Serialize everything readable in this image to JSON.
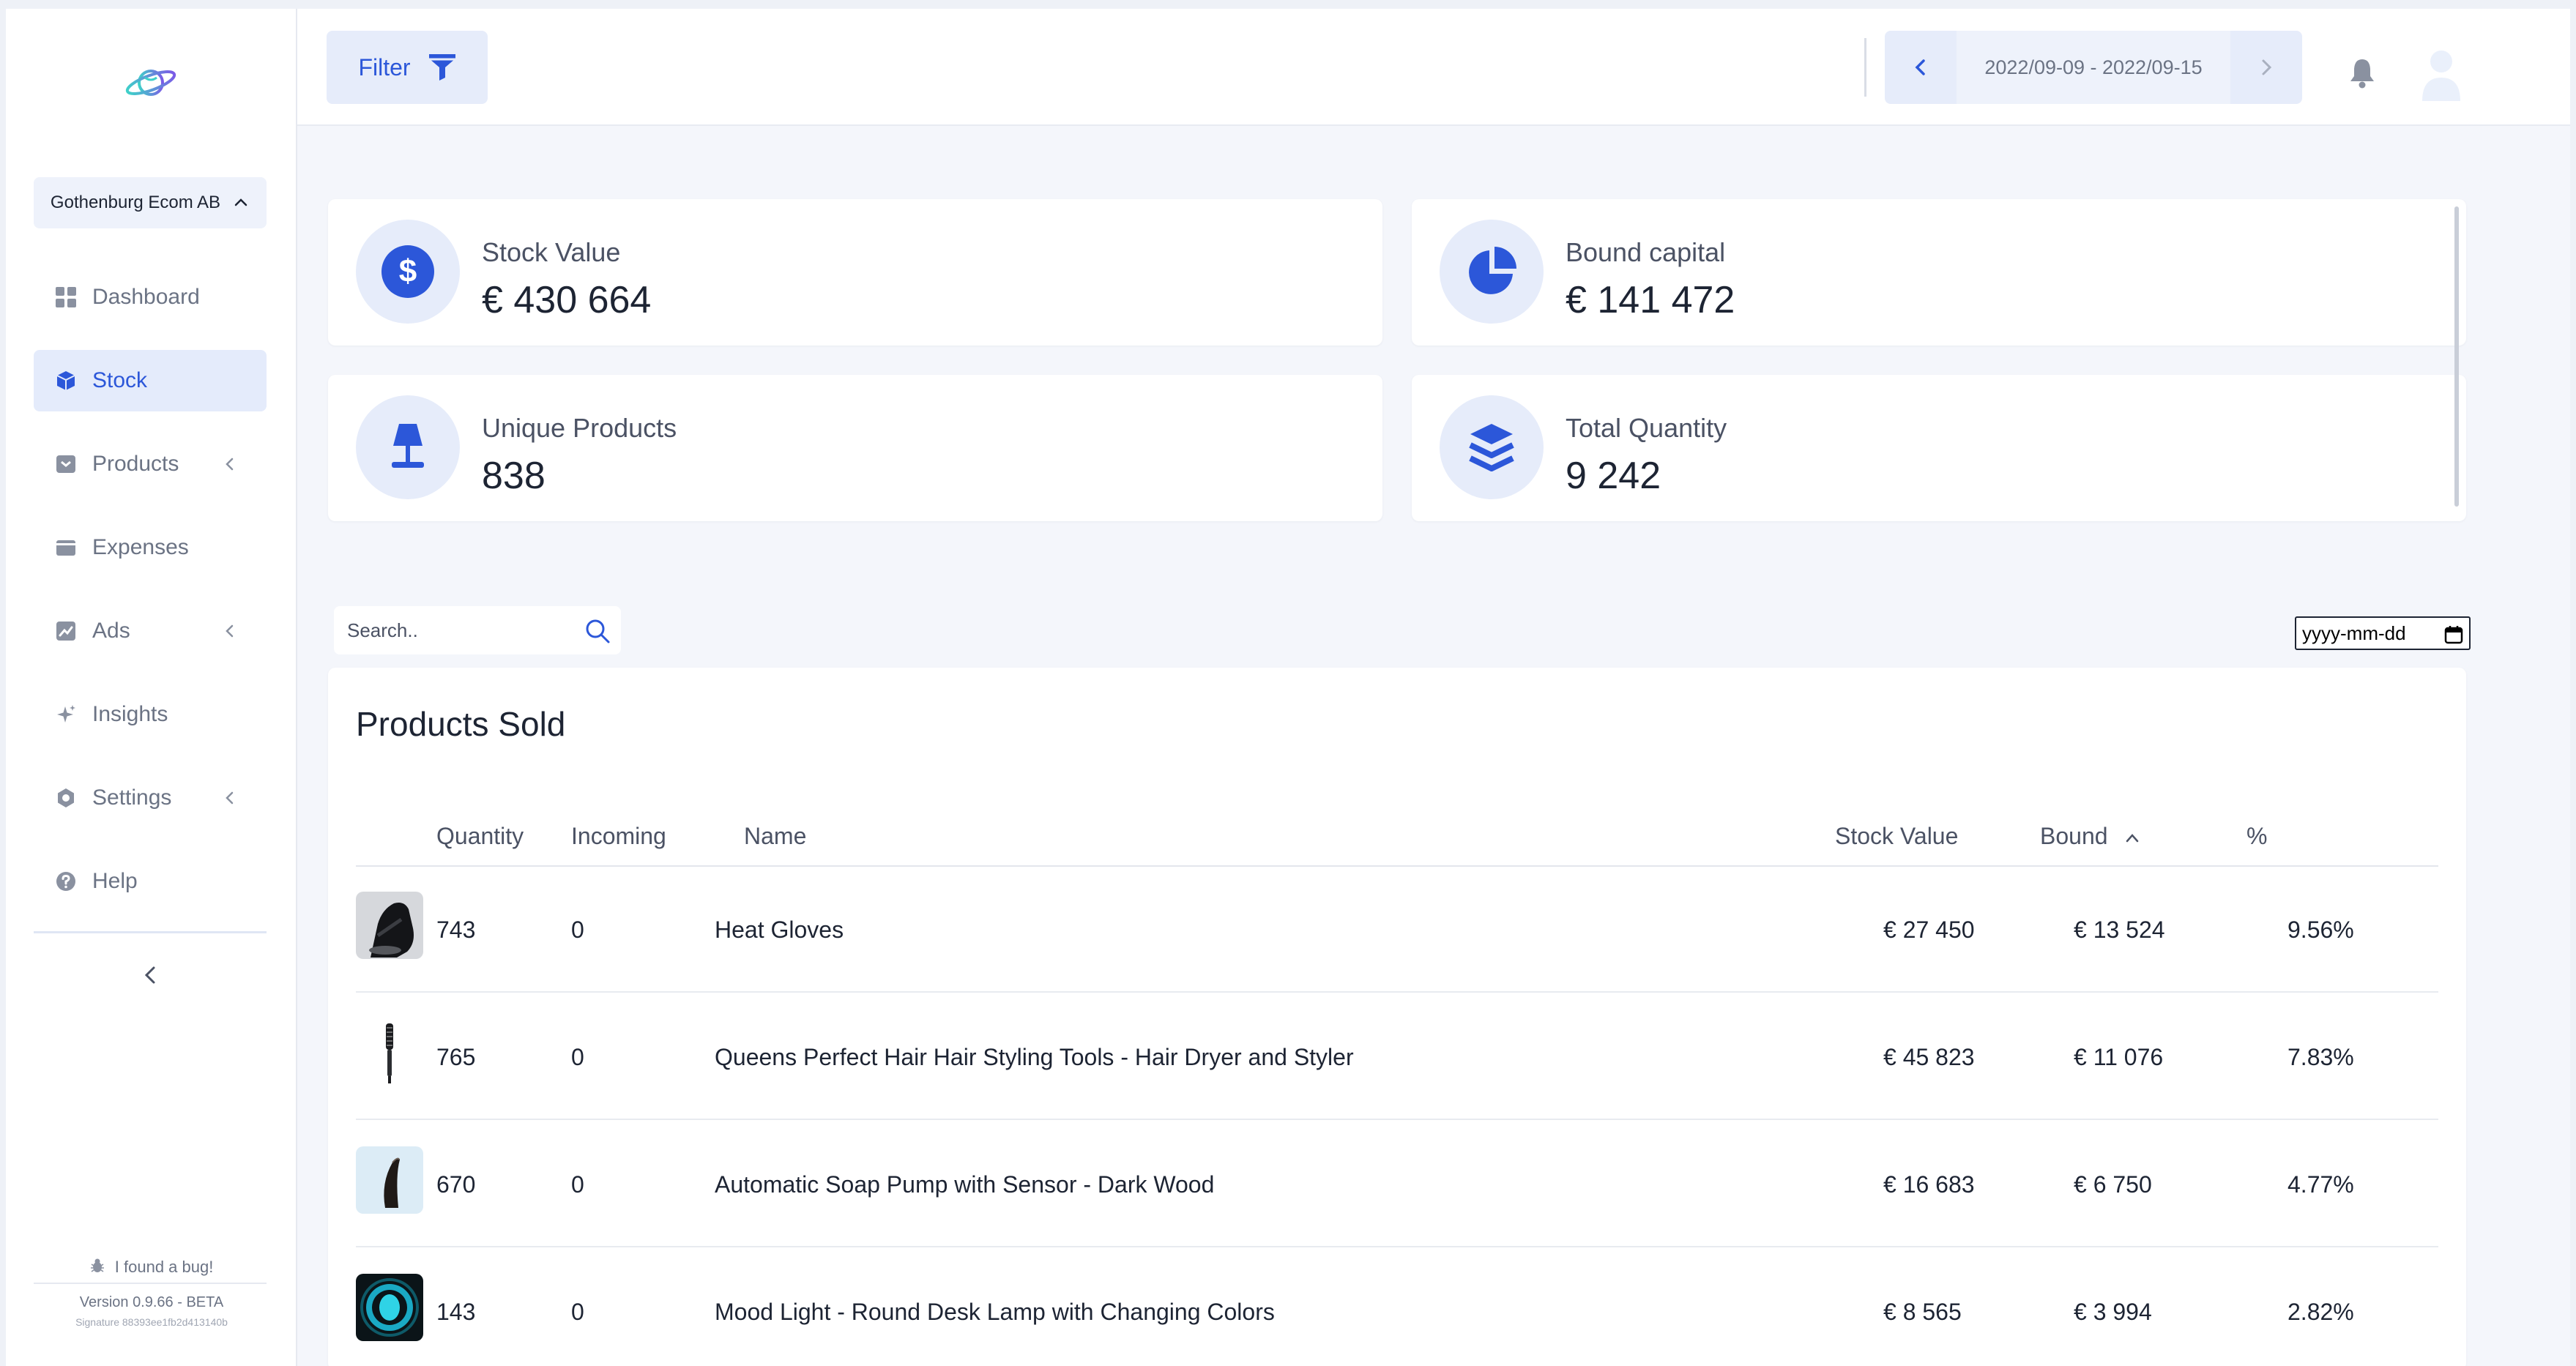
{
  "sidebar": {
    "company": "Gothenburg Ecom AB",
    "nav": [
      {
        "label": "Dashboard",
        "icon": "dashboard-icon"
      },
      {
        "label": "Stock",
        "icon": "cube-icon"
      },
      {
        "label": "Products",
        "icon": "archive-box-icon"
      },
      {
        "label": "Expenses",
        "icon": "wallet-icon"
      },
      {
        "label": "Ads",
        "icon": "chart-line-icon"
      },
      {
        "label": "Insights",
        "icon": "sparkles-icon"
      },
      {
        "label": "Settings",
        "icon": "gear-icon"
      },
      {
        "label": "Help",
        "icon": "help-circle-icon"
      }
    ],
    "active": "Stock",
    "bug_report": "I found a bug!",
    "version": "Version 0.9.66 - BETA",
    "signature": "Signature 88393ee1fb2d413140b"
  },
  "topbar": {
    "filter_label": "Filter",
    "date_range": "2022/09-09  -  2022/09-15"
  },
  "stats": [
    {
      "label": "Stock Value",
      "value": "€ 430 664",
      "icon": "dollar-icon"
    },
    {
      "label": "Bound capital",
      "value": "€ 141 472",
      "icon": "pie-chart-icon"
    },
    {
      "label": "Unique Products",
      "value": "838",
      "icon": "lamp-icon"
    },
    {
      "label": "Total Quantity",
      "value": "9 242",
      "icon": "layers-icon"
    }
  ],
  "search": {
    "placeholder": "Search.."
  },
  "date_filter": {
    "placeholder": "yyyy-mm-dd"
  },
  "products": {
    "title": "Products Sold",
    "columns": [
      "Quantity",
      "Incoming",
      "Name",
      "Stock Value",
      "Bound",
      "%"
    ],
    "sorted_column": "Bound",
    "rows": [
      {
        "quantity": "743",
        "incoming": "0",
        "name": "Heat Gloves",
        "stock_value": "€ 27 450",
        "bound": "€ 13 524",
        "percent": "9.56%",
        "thumb": "glove-thumbnail"
      },
      {
        "quantity": "765",
        "incoming": "0",
        "name": "Queens Perfect Hair Hair Styling Tools - Hair Dryer and Styler",
        "stock_value": "€ 45 823",
        "bound": "€ 11 076",
        "percent": "7.83%",
        "thumb": "hair-brush-thumbnail"
      },
      {
        "quantity": "670",
        "incoming": "0",
        "name": "Automatic Soap Pump with Sensor - Dark Wood",
        "stock_value": "€ 16 683",
        "bound": "€ 6 750",
        "percent": "4.77%",
        "thumb": "soap-pump-thumbnail"
      },
      {
        "quantity": "143",
        "incoming": "0",
        "name": "Mood Light - Round Desk Lamp with Changing Colors",
        "stock_value": "€ 8 565",
        "bound": "€ 3 994",
        "percent": "2.82%",
        "thumb": "mood-light-thumbnail"
      }
    ]
  },
  "colors": {
    "accent": "#2c57d9",
    "accent_bg": "#e6ecfa",
    "muted_text": "#6b7384",
    "page_bg": "#f4f6fb"
  }
}
